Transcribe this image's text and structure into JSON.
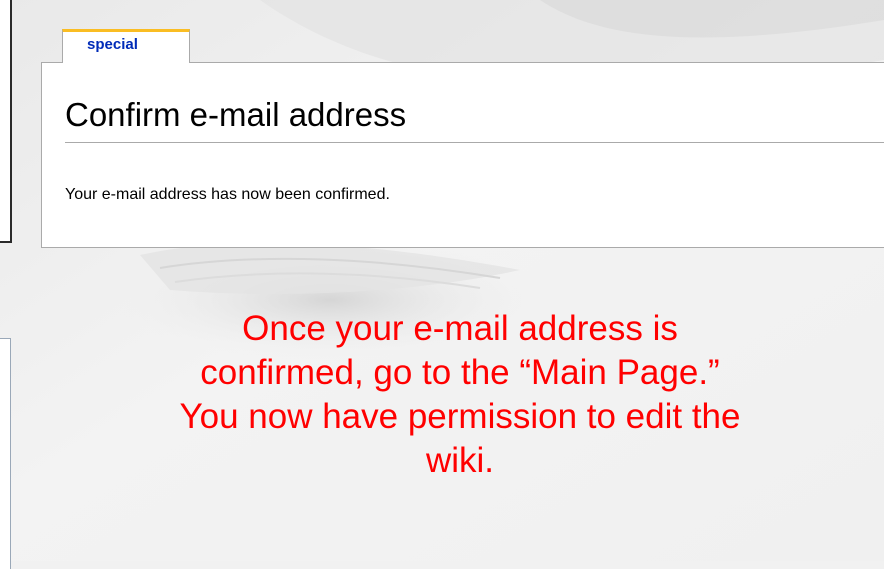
{
  "tab": {
    "label": "special"
  },
  "page": {
    "title": "Confirm e-mail address",
    "message": "Your e-mail address has now been confirmed."
  },
  "annotation": {
    "lines": [
      "Once your e-mail address is",
      "confirmed, go to the “Main Page.”",
      "You now have permission to edit the",
      "wiki."
    ]
  },
  "colors": {
    "annotation_text": "#ff0000",
    "tab_link": "#002bb8",
    "tab_accent": "#fabd23",
    "border": "#aaaaaa"
  }
}
